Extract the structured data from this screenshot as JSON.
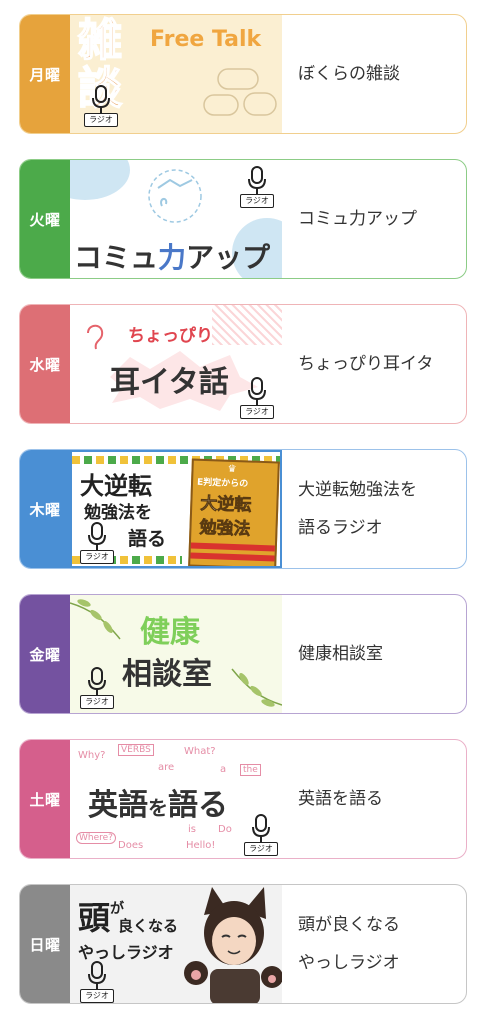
{
  "programs": [
    {
      "day": "月曜",
      "title": "ぼくらの雑談",
      "color": "#e6a33c",
      "border": "#f1cf8e",
      "thumb": {
        "main": "雑談",
        "sub": "Free Talk",
        "radio_tag": "ラジオ"
      }
    },
    {
      "day": "火曜",
      "title": "コミュ力アップ",
      "color": "#4caa4a",
      "border": "#8ccc86",
      "thumb": {
        "main_a": "コミュ",
        "main_b": "力",
        "main_c": "アップ",
        "radio_tag": "ラジオ"
      }
    },
    {
      "day": "水曜",
      "title": "ちょっぴり耳イタ",
      "color": "#dd6f75",
      "border": "#efb4b7",
      "thumb": {
        "sub": "ちょっぴり",
        "main": "耳イタ話",
        "radio_tag": "ラジオ"
      }
    },
    {
      "day": "木曜",
      "title": "大逆転勉強法を\n語るラジオ",
      "color": "#4a8fd4",
      "border": "#9cc2ea",
      "thumb": {
        "line1": "大逆転",
        "line2": "勉強法を",
        "line3": "語る",
        "book_top": "E判定からの",
        "book_main1": "大逆転",
        "book_main2": "勉強法",
        "radio_tag": "ラジオ"
      }
    },
    {
      "day": "金曜",
      "title": "健康相談室",
      "color": "#7452a0",
      "border": "#b7a4d2",
      "thumb": {
        "line1": "健康",
        "line2": "相談室",
        "radio_tag": "ラジオ"
      }
    },
    {
      "day": "土曜",
      "title": "英語を語る",
      "color": "#d55f8c",
      "border": "#eab0c8",
      "thumb": {
        "main_a": "英語",
        "main_b": "を",
        "main_c": "語る",
        "radio_tag": "ラジオ",
        "doodles": [
          "Why?",
          "VERBS",
          "What?",
          "are",
          "the",
          "Where?",
          "Does",
          "is",
          "Hello!",
          "Do",
          "a"
        ]
      }
    },
    {
      "day": "日曜",
      "title": "頭が良くなる\nやっしラジオ",
      "color": "#8a8a8a",
      "border": "#c6c6c6",
      "thumb": {
        "line1": "頭",
        "line1b": "が",
        "line1c": "良くなる",
        "line2": "やっしラジオ",
        "radio_tag": "ラジオ"
      }
    }
  ]
}
